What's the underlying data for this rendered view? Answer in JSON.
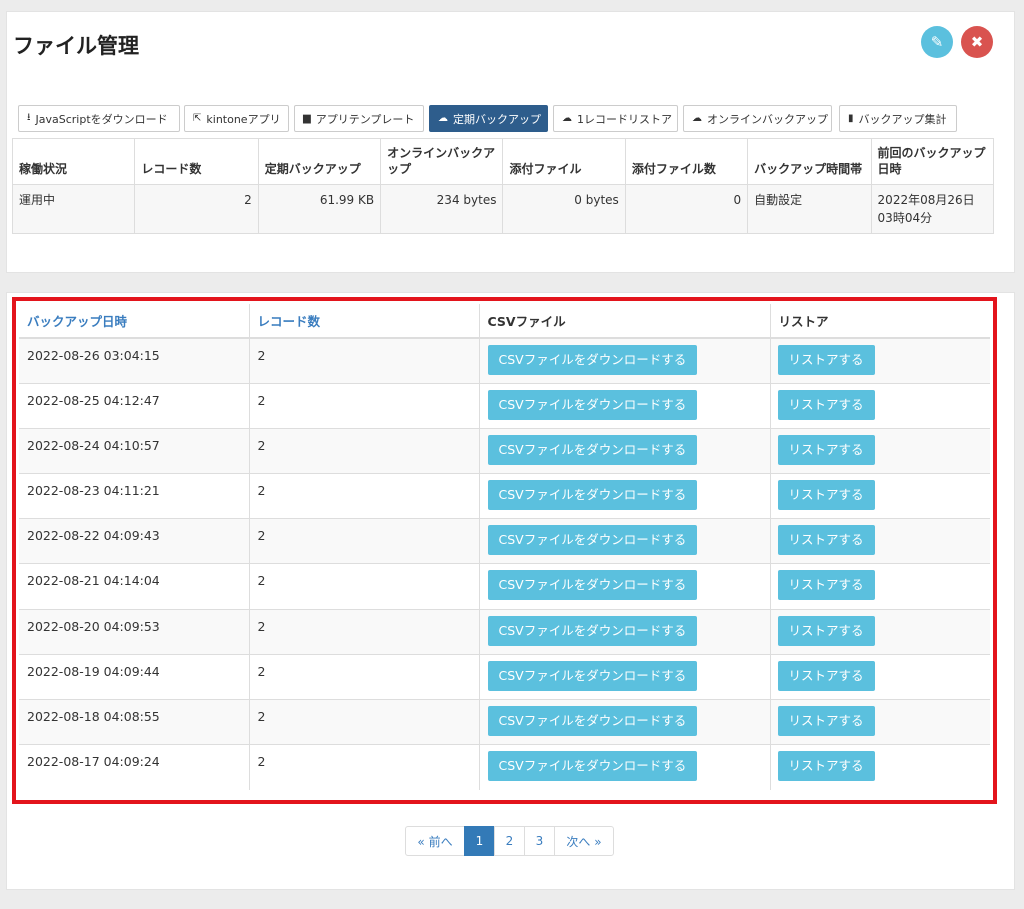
{
  "header": {
    "title": "ファイル管理"
  },
  "actions": {
    "edit_icon": "✎",
    "close_icon": "✖"
  },
  "toolbar": [
    {
      "icon": "⭳",
      "label": "JavaScriptをダウンロード",
      "active": false
    },
    {
      "icon": "⇱",
      "label": "kintoneアプリ",
      "active": false
    },
    {
      "icon": "▆",
      "label": "アプリテンプレート",
      "active": false
    },
    {
      "icon": "☁",
      "label": "定期バックアップ",
      "active": true
    },
    {
      "icon": "☁",
      "label": "1レコードリストア",
      "active": false
    },
    {
      "icon": "☁",
      "label": "オンラインバックアップ",
      "active": false
    },
    {
      "icon": "▮",
      "label": "バックアップ集計",
      "active": false
    }
  ],
  "info_table": {
    "headers": [
      "稼働状況",
      "レコード数",
      "定期バックアップ",
      "オンラインバックアップ",
      "添付ファイル",
      "添付ファイル数",
      "バックアップ時間帯",
      "前回のバックアップ日時"
    ],
    "row": [
      "運用中",
      "2",
      "61.99 KB",
      "234 bytes",
      "0 bytes",
      "0",
      "自動設定",
      "2022年08月26日 03時04分"
    ]
  },
  "backup_table": {
    "headers": [
      "バックアップ日時",
      "レコード数",
      "CSVファイル",
      "リストア"
    ],
    "csv_button_label": "CSVファイルをダウンロードする",
    "restore_button_label": "リストアする",
    "rows": [
      {
        "datetime": "2022-08-26 03:04:15",
        "records": "2"
      },
      {
        "datetime": "2022-08-25 04:12:47",
        "records": "2"
      },
      {
        "datetime": "2022-08-24 04:10:57",
        "records": "2"
      },
      {
        "datetime": "2022-08-23 04:11:21",
        "records": "2"
      },
      {
        "datetime": "2022-08-22 04:09:43",
        "records": "2"
      },
      {
        "datetime": "2022-08-21 04:14:04",
        "records": "2"
      },
      {
        "datetime": "2022-08-20 04:09:53",
        "records": "2"
      },
      {
        "datetime": "2022-08-19 04:09:44",
        "records": "2"
      },
      {
        "datetime": "2022-08-18 04:08:55",
        "records": "2"
      },
      {
        "datetime": "2022-08-17 04:09:24",
        "records": "2"
      }
    ]
  },
  "pagination": {
    "prev_label": "« 前へ",
    "pages": [
      "1",
      "2",
      "3"
    ],
    "active_page": "1",
    "next_label": "次へ »"
  }
}
